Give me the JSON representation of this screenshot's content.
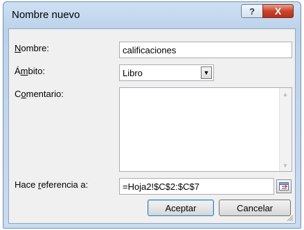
{
  "dialog": {
    "title": "Nombre nuevo",
    "help_label": "?",
    "close_label": "X"
  },
  "form": {
    "name_label_underlined": "N",
    "name_label_rest": "ombre:",
    "name_value": "calificaciones",
    "scope_label_pre": "Á",
    "scope_label_underlined": "m",
    "scope_label_rest": "bito:",
    "scope_value": "Libro",
    "comment_label_pre": "C",
    "comment_label_underlined": "o",
    "comment_label_rest": "mentario:",
    "comment_value": "",
    "refers_label_pre": "Hace ",
    "refers_label_underlined": "r",
    "refers_label_rest": "eferencia a:",
    "refers_value": "=Hoja2!$C$2:$C$7"
  },
  "buttons": {
    "ok_label": "Aceptar",
    "cancel_label": "Cancelar"
  },
  "icons": {
    "combo_arrow": "chevron-down-icon",
    "ref_picker": "range-select-icon",
    "scroll_up": "arrow-up-icon",
    "scroll_down": "arrow-down-icon"
  }
}
